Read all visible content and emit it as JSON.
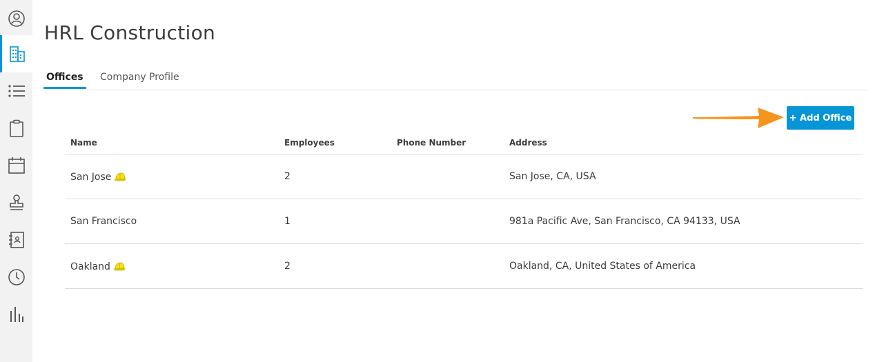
{
  "app": {
    "company_name": "HRL Construction"
  },
  "sidebar": {
    "items": [
      {
        "icon": "user-circle-icon",
        "active": false
      },
      {
        "icon": "building-icon",
        "active": true
      },
      {
        "icon": "list-icon",
        "active": false
      },
      {
        "icon": "clipboard-icon",
        "active": false
      },
      {
        "icon": "calendar-icon",
        "active": false
      },
      {
        "icon": "stamp-icon",
        "active": false
      },
      {
        "icon": "contact-book-icon",
        "active": false
      },
      {
        "icon": "clock-icon",
        "active": false
      },
      {
        "icon": "bar-chart-icon",
        "active": false
      }
    ],
    "accent_color": "#0696d7"
  },
  "tabs": [
    {
      "label": "Offices",
      "active": true
    },
    {
      "label": "Company Profile",
      "active": false
    }
  ],
  "toolbar": {
    "add_office_label": "+ Add Office"
  },
  "annotation": {
    "arrow_color": "#f7941d"
  },
  "table": {
    "columns": [
      "Name",
      "Employees",
      "Phone Number",
      "Address"
    ],
    "rows": [
      {
        "name": "San Jose",
        "hq": true,
        "employees": "2",
        "phone": "",
        "address": "San Jose, CA, USA"
      },
      {
        "name": "San Francisco",
        "hq": false,
        "employees": "1",
        "phone": "",
        "address": "981a Pacific Ave, San Francisco, CA 94133, USA"
      },
      {
        "name": "Oakland",
        "hq": true,
        "employees": "2",
        "phone": "",
        "address": "Oakland, CA, United States of America"
      }
    ]
  }
}
